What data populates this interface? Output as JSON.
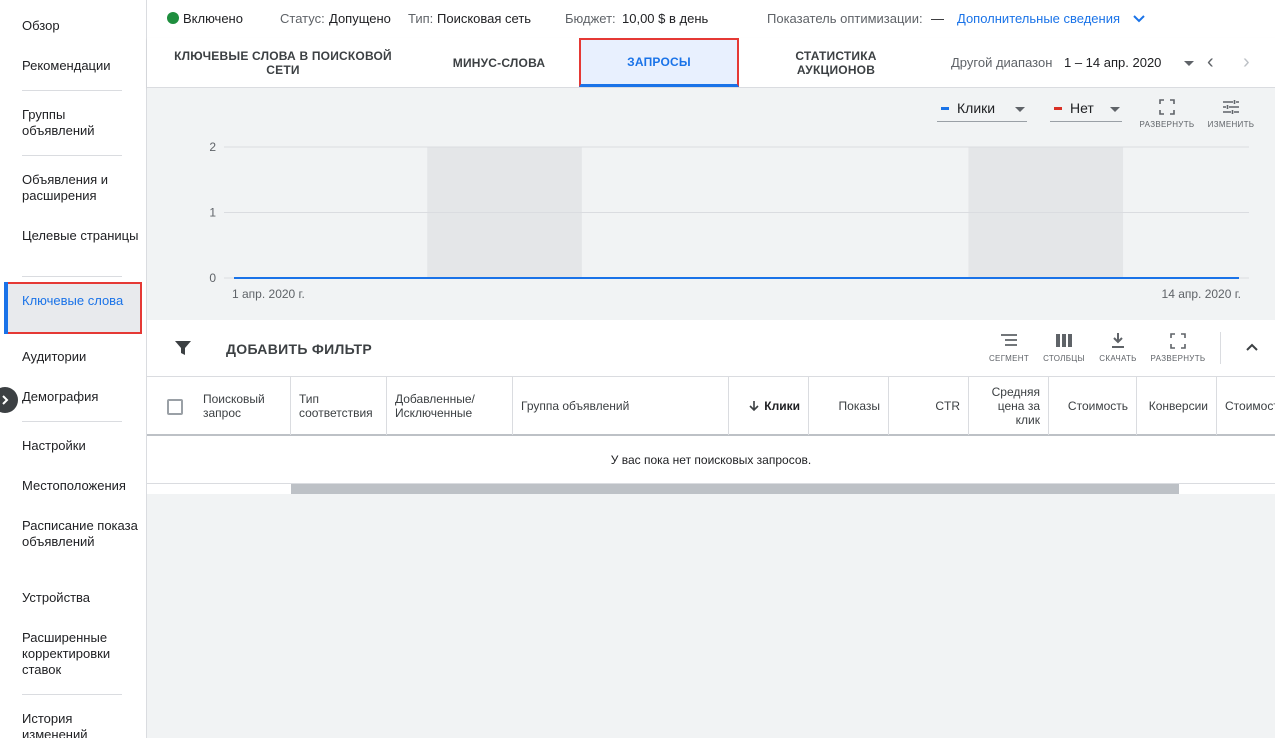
{
  "sidebar": {
    "items": [
      {
        "label": "Обзор"
      },
      {
        "label": "Рекомендации"
      },
      {
        "label": "Группы объявлений"
      },
      {
        "label": "Объявления и расширения"
      },
      {
        "label": "Целевые страницы"
      },
      {
        "label": "Ключевые слова"
      },
      {
        "label": "Аудитории"
      },
      {
        "label": "Демография"
      },
      {
        "label": "Настройки"
      },
      {
        "label": "Местоположения"
      },
      {
        "label": "Расписание показа объявлений"
      },
      {
        "label": "Устройства"
      },
      {
        "label": "Расширенные корректировки ставок"
      },
      {
        "label": "История изменений"
      }
    ]
  },
  "status": {
    "state": "Включено",
    "status_label": "Статус:",
    "status_value": "Допущено",
    "type_label": "Тип:",
    "type_value": "Поисковая сеть",
    "budget_label": "Бюджет:",
    "budget_value": "10,00 $ в день",
    "optimization_label": "Показатель оптимизации:",
    "optimization_value": "—",
    "details_link": "Дополнительные сведения"
  },
  "tabs": [
    {
      "label": "Ключевые слова в поисковой сети"
    },
    {
      "label": "Минус-слова"
    },
    {
      "label": "Запросы"
    },
    {
      "label": "Статистика аукционов"
    }
  ],
  "date_range": {
    "label": "Другой диапазон",
    "value": "1 – 14 апр. 2020"
  },
  "chart_controls": {
    "metric1": "Клики",
    "metric2": "Нет",
    "expand": "РАЗВЕРНУТЬ",
    "adjust": "ИЗМЕНИТЬ",
    "colors": {
      "metric1": "#1a73e8",
      "metric2": "#d93025"
    }
  },
  "chart_data": {
    "type": "line",
    "x_start_label": "1 апр. 2020 г.",
    "x_end_label": "14 апр. 2020 г.",
    "y_ticks": [
      "2",
      "1",
      "0"
    ],
    "ylim": [
      0,
      2
    ],
    "series": [
      {
        "values": [
          0,
          0,
          0,
          0,
          0,
          0,
          0,
          0,
          0,
          0,
          0,
          0,
          0,
          0
        ]
      }
    ],
    "grid": true
  },
  "table_toolbar": {
    "add_filter": "ДОБАВИТЬ ФИЛЬТР",
    "segment": "СЕГМЕНТ",
    "columns": "СТОЛБЦЫ",
    "download": "СКАЧАТЬ",
    "expand": "РАЗВЕРНУТЬ"
  },
  "table": {
    "headers": {
      "query": "Поисковый запрос",
      "match_type": "Тип соответствия",
      "added_excluded": "Добавленные/ Исключенные",
      "ad_group": "Группа объявлений",
      "clicks": "Клики",
      "impressions": "Показы",
      "ctr": "CTR",
      "avg_cpc": "Средняя цена за клик",
      "cost": "Стоимость",
      "conversions": "Конверсии",
      "cost_conv": "Стоимость ко"
    },
    "empty_message": "У вас пока нет поисковых запросов."
  }
}
